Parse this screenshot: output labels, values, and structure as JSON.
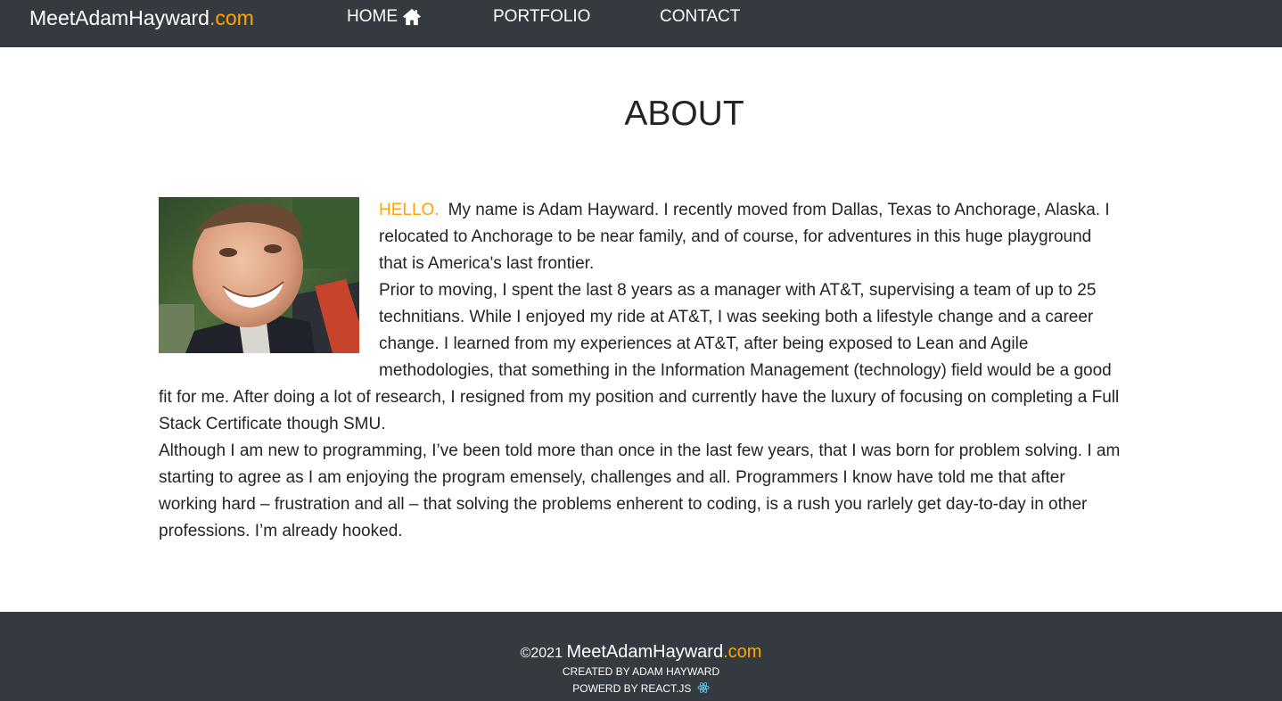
{
  "nav": {
    "brand_main": "MeetAdamHayward",
    "brand_tld": ".com",
    "items": [
      {
        "label": "HOME",
        "icon": "home-icon"
      },
      {
        "label": "PORTFOLIO"
      },
      {
        "label": "CONTACT"
      }
    ]
  },
  "about": {
    "title": "ABOUT",
    "photo": {
      "icon": "profile-photo"
    },
    "hello": "HELLO.",
    "paragraphs": [
      "My name is Adam Hayward. I recently moved from Dallas, Texas to Anchorage, Alaska. I relocated to Anchorage to be near family, and of course, for adventures in this huge playground that is America's last frontier.",
      "Prior to moving, I spent the last 8 years as a manager with AT&T, supervising a team of up to 25 technitians. While I enjoyed my ride at AT&T, I was seeking both a lifestyle change and a career change. I learned from my experiences at AT&T, after being exposed to Lean and Agile methodologies, that something in the Information Management (technology) field would be a good fit for me. After doing a lot of research, I resigned from my position and currently have the luxury of focusing on completing a Full Stack Certificate though SMU.",
      "Although I am new to programming, I’ve been told more than once in the last few years, that I was born for problem solving. I am starting to agree as I am enjoying the program emensely, challenges and all. Programmers I know have told me that after working hard – frustration and all – that solving the problems enherent to coding, is a rush you rarlely get day-to-day in other professions. I’m already hooked."
    ]
  },
  "footer": {
    "copyright": "©2021",
    "site_main": "MeetAdamHayward",
    "site_tld": ".com",
    "created_by": "CREATED BY ADAM HAYWARD",
    "powered_by": "POWERD BY REACT.JS"
  },
  "colors": {
    "navbar_bg": "#343a40",
    "accent": "#ffa500",
    "text": "#212529",
    "react_blue": "#61dafb"
  }
}
